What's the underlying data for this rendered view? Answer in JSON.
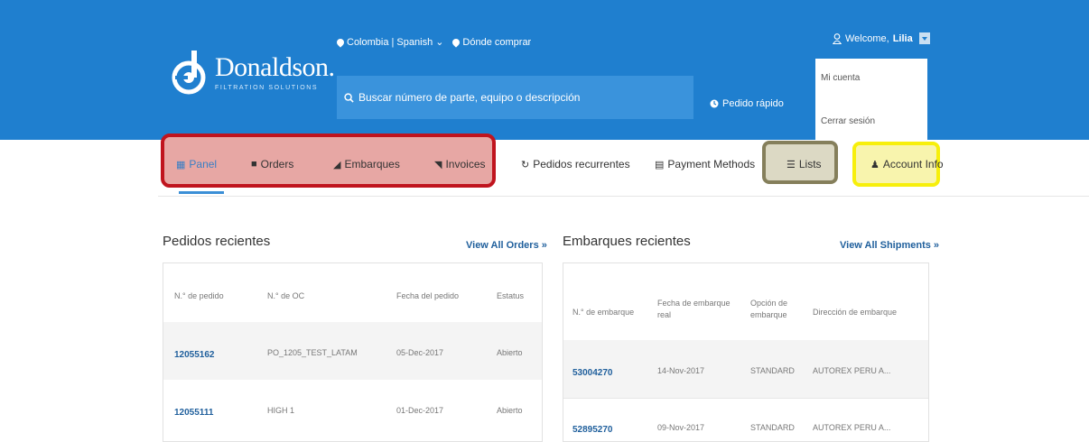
{
  "header": {
    "brand": "Donaldson.",
    "tagline": "FILTRATION SOLUTIONS",
    "region": "Colombia | Spanish",
    "where_to_buy": "Dónde comprar",
    "search_placeholder": "Buscar número de parte, equipo o descripción",
    "quick_order": "Pedido rápido",
    "welcome": "Welcome,",
    "user": "Lilia",
    "menu": [
      "Mi cuenta",
      "Cerrar sesión"
    ]
  },
  "nav": {
    "items": [
      "Panel",
      "Orders",
      "Embarques",
      "Invoices",
      "Pedidos recurrentes",
      "Payment Methods",
      "Lists",
      "Account Info"
    ]
  },
  "orders": {
    "title": "Pedidos recientes",
    "view_all": "View All Orders »",
    "columns": [
      "N.° de pedido",
      "N.° de OC",
      "Fecha del pedido",
      "Estatus"
    ],
    "rows": [
      [
        "12055162",
        "PO_1205_TEST_LATAM",
        "05-Dec-2017",
        "Abierto"
      ],
      [
        "12055111",
        "HIGH 1",
        "01-Dec-2017",
        "Abierto"
      ]
    ]
  },
  "shipments": {
    "title": "Embarques recientes",
    "view_all": "View All Shipments »",
    "columns": [
      "N.° de embarque",
      "Fecha de embarque real",
      "Opción de embarque",
      "Dirección de embarque"
    ],
    "rows": [
      [
        "53004270",
        "14-Nov-2017",
        "STANDARD",
        "AUTOREX PERU A..."
      ],
      [
        "52895270",
        "09-Nov-2017",
        "STANDARD",
        "AUTOREX PERU A..."
      ]
    ]
  },
  "colors": {
    "header_bg": "#1f7fcf",
    "highlight_red": "#c0141e",
    "highlight_olive": "#857f5b",
    "highlight_yellow": "#f7ef0b"
  }
}
